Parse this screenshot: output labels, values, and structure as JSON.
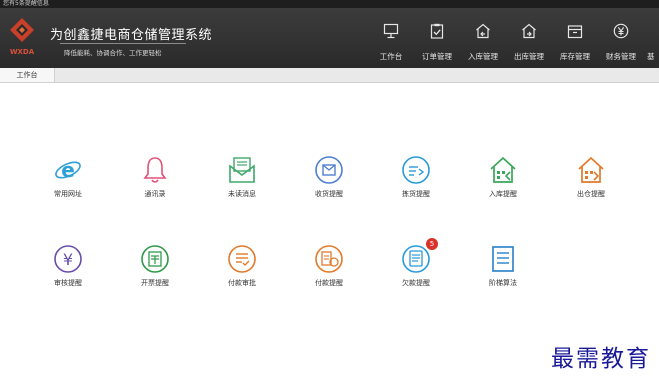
{
  "top_notice": "您有5条提醒信息",
  "brand": {
    "logo_text": "WXDA",
    "title": "为创鑫捷电商仓储管理系统",
    "slogan": "降低能耗、协调合作、工作更轻松"
  },
  "nav": [
    {
      "label": "工作台",
      "icon": "monitor-icon"
    },
    {
      "label": "订单管理",
      "icon": "clipboard-check-icon"
    },
    {
      "label": "入库管理",
      "icon": "warehouse-in-icon"
    },
    {
      "label": "出库管理",
      "icon": "warehouse-out-icon"
    },
    {
      "label": "库存管理",
      "icon": "box-icon"
    },
    {
      "label": "财务管理",
      "icon": "yen-circle-icon"
    },
    {
      "label": "基"
    }
  ],
  "tabs": [
    {
      "label": "工作台"
    }
  ],
  "tiles": [
    {
      "label": "常用网址",
      "icon": "ie-browser-icon",
      "color": "#2f9fd8"
    },
    {
      "label": "通讯录",
      "icon": "bell-icon",
      "color": "#e2507a"
    },
    {
      "label": "未读消息",
      "icon": "envelope-icon",
      "color": "#3fa86a"
    },
    {
      "label": "收货提醒",
      "icon": "receive-icon",
      "color": "#4f7fd0"
    },
    {
      "label": "拣货提醒",
      "icon": "picking-icon",
      "color": "#2a9ad8"
    },
    {
      "label": "入库提醒",
      "icon": "house-in-icon",
      "color": "#3aa65a"
    },
    {
      "label": "出仓提醒",
      "icon": "house-out-icon",
      "color": "#e07a2c"
    },
    {
      "label": "审核提醒",
      "icon": "yen-icon",
      "color": "#6a4ea8"
    },
    {
      "label": "开票提醒",
      "icon": "invoice-icon",
      "color": "#2f9a4a"
    },
    {
      "label": "付款审批",
      "icon": "approval-icon",
      "color": "#e07a2c"
    },
    {
      "label": "付款提醒",
      "icon": "payment-icon",
      "color": "#e07a2c"
    },
    {
      "label": "欠款提醒",
      "icon": "debt-icon",
      "color": "#2a9ad8",
      "badge": "5"
    },
    {
      "label": "阶梯算法",
      "icon": "list-icon",
      "color": "#2a7fc8"
    }
  ],
  "watermark": "最需教育"
}
